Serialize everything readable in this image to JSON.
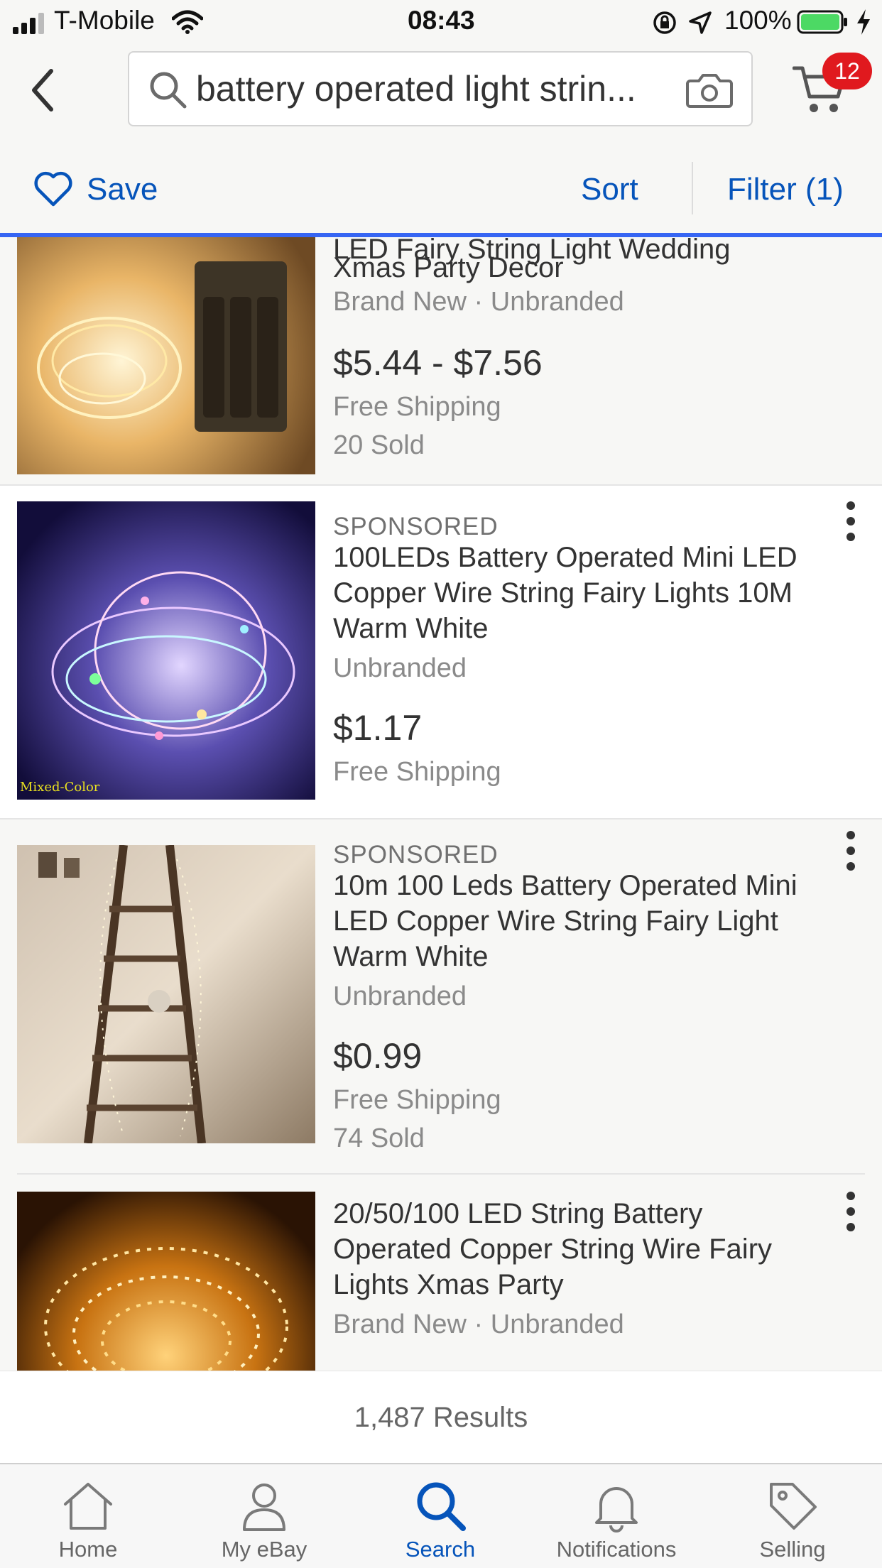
{
  "status_bar": {
    "carrier": "T-Mobile",
    "time": "08:43",
    "battery": "100%"
  },
  "header": {
    "search_query": "battery operated light strin...",
    "cart_count": "12"
  },
  "action_bar": {
    "save_label": "Save",
    "sort_label": "Sort",
    "filter_label": "Filter (1)"
  },
  "listings": [
    {
      "title_cut": "LED Fairy String Light Wedding",
      "title_lines": [
        "Xmas Party Decor"
      ],
      "condition": "Brand New · Unbranded",
      "price": "$5.44 - $7.56",
      "shipping": "Free Shipping",
      "sold": "20 Sold"
    },
    {
      "sponsored": "SPONSORED",
      "title_lines": [
        "100LEDs Battery Operated Mini LED",
        "Copper Wire String Fairy Lights 10M",
        "Warm White"
      ],
      "condition": "Unbranded",
      "price": "$1.17",
      "shipping": "Free Shipping",
      "image_caption": "Mixed-Color"
    },
    {
      "sponsored": "SPONSORED",
      "title_lines": [
        "10m 100 Leds Battery Operated Mini",
        "LED Copper Wire String Fairy Light",
        "Warm White"
      ],
      "condition": "Unbranded",
      "price": "$0.99",
      "shipping": "Free Shipping",
      "sold": "74 Sold"
    },
    {
      "title_lines": [
        "20/50/100 LED String Battery",
        "Operated Copper String Wire Fairy",
        "Lights Xmas Party"
      ],
      "condition": "Brand New · Unbranded"
    }
  ],
  "results_count": "1,487 Results",
  "tabs": [
    {
      "label": "Home",
      "icon": "home-icon"
    },
    {
      "label": "My eBay",
      "icon": "person-icon"
    },
    {
      "label": "Search",
      "icon": "search-icon",
      "active": true
    },
    {
      "label": "Notifications",
      "icon": "bell-icon"
    },
    {
      "label": "Selling",
      "icon": "tag-icon"
    }
  ],
  "colors": {
    "link_blue": "#0654ba",
    "accent_line": "#3665f3",
    "badge_red": "#e0191e"
  }
}
